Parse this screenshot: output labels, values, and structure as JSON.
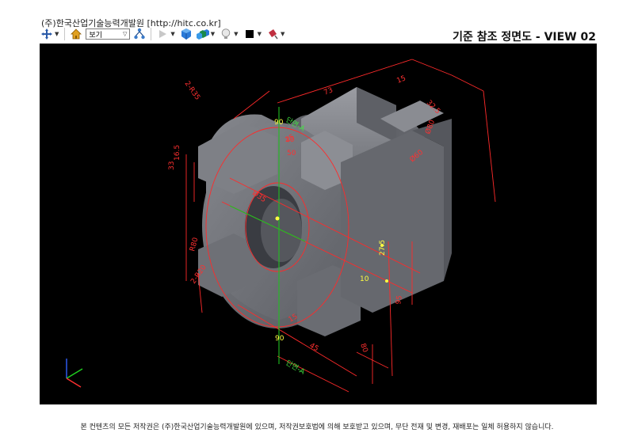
{
  "window": {
    "org_header": "(주)한국산업기술능력개발원 [http://hitc.co.kr]"
  },
  "toolbar": {
    "view_select_value": "보기",
    "icons": [
      "move-icon",
      "home-icon",
      "view-select",
      "hierarchy-icon",
      "play-icon",
      "cube-icon",
      "cubes-icon",
      "lightbulb-icon",
      "color-swatch-icon",
      "paint-icon"
    ],
    "swatch_color": "#000000"
  },
  "page": {
    "title": "기준 참조 정면도 - VIEW 02"
  },
  "drawing": {
    "dimensions": {
      "d_2r35": "2-R35",
      "d_73": "73",
      "d_15_top": "15",
      "d_32_5": "32.5",
      "d_phi80": "Ø80",
      "d_phi60": "Ø60",
      "d_90_top": "90",
      "d_20": "20",
      "d_15_mid": "15",
      "d_50": "50",
      "d_16_5": "16.5",
      "d_33": "33",
      "d_phi35": "Ø35",
      "d_r80": "R80",
      "d_2r20": "2-R20",
      "d_27_5": "27.5",
      "d_10": "10",
      "d_95": "95",
      "d_15_bottom": "15",
      "d_90_bottom": "90",
      "d_45": "45",
      "d_80": "80"
    },
    "section_labels": {
      "top": "단면-A",
      "bottom": "단면-A"
    },
    "colors": {
      "background": "#000000",
      "body": "#6e7076",
      "dimension": "#ff3030",
      "centerline": "#20c020",
      "highlight": "#ffff40"
    }
  },
  "footer": {
    "copyright": "본 컨텐츠의 모든 저작권은 (주)한국산업기술능력개발원에 있으며, 저작권보호법에 의해 보호받고 있으며, 무단 전재 및 변경, 재배포는 일체 허용하지 않습니다."
  }
}
